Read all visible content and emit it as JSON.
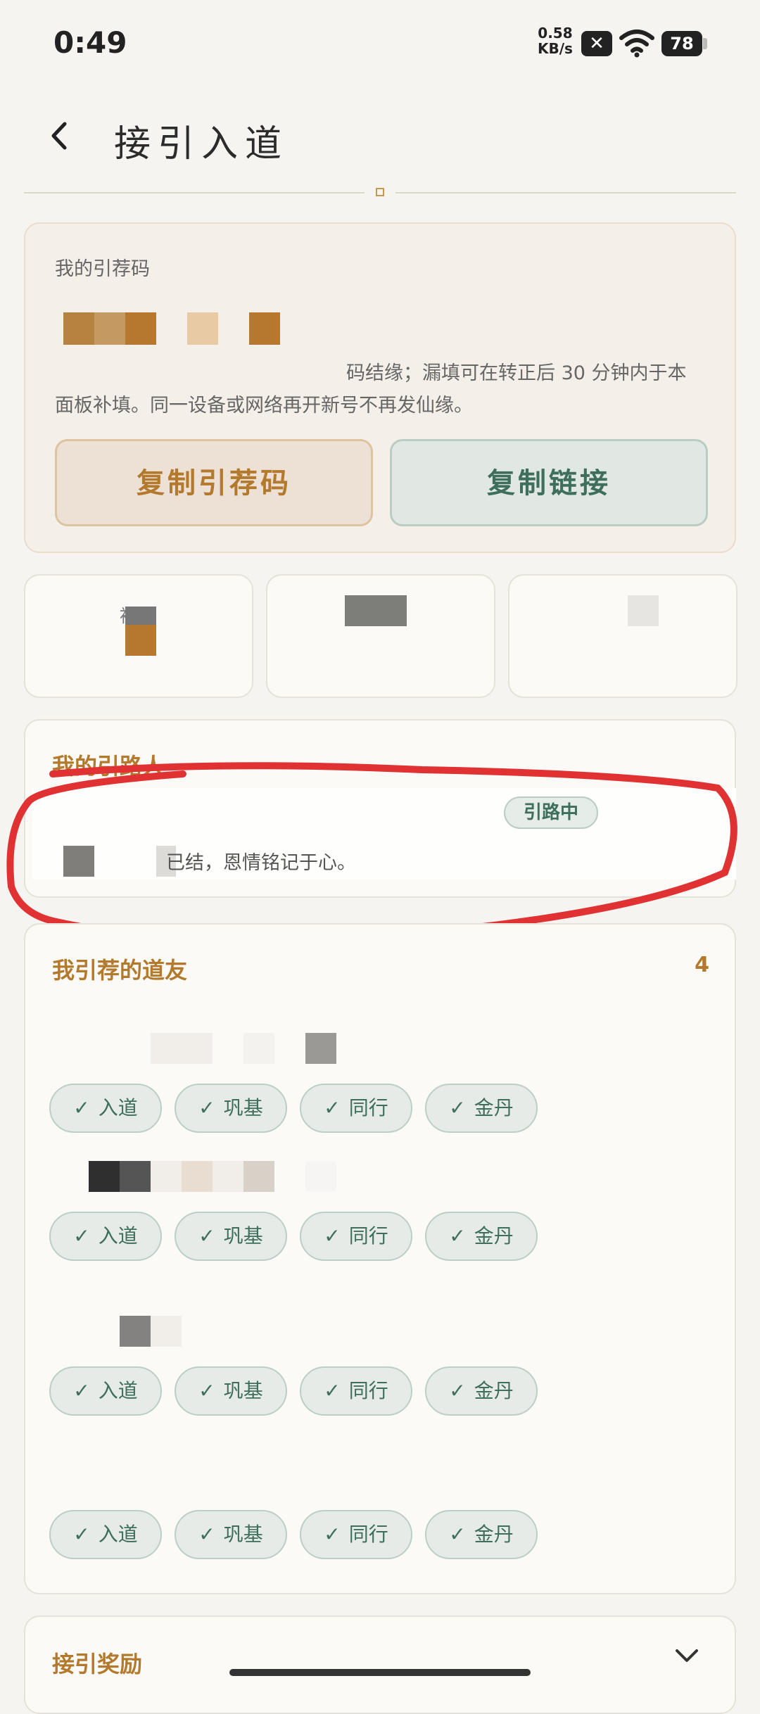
{
  "status_bar": {
    "time": "0:49",
    "net_speed_value": "0.58",
    "net_speed_unit": "KB/s",
    "battery": "78"
  },
  "header": {
    "title": "接引入道"
  },
  "referral_code": {
    "label": "我的引荐码",
    "note_line1": "码结缘；漏填可在转正后 30 分钟内于本",
    "note_line2": "面板补填。同一设备或网络再开新号不再发仙缘。",
    "copy_code_label": "复制引荐码",
    "copy_link_label": "复制链接"
  },
  "stats": {
    "first_label": "被引"
  },
  "guide": {
    "title": "我的引路人",
    "status": "引路中",
    "description": "已结，恩情铭记于心。"
  },
  "friends": {
    "title": "我引荐的道友",
    "count": "4",
    "tag_check_icon": "check-icon",
    "rows": [
      {
        "tags": [
          "入道",
          "巩基",
          "同行",
          "金丹"
        ]
      },
      {
        "tags": [
          "入道",
          "巩基",
          "同行",
          "金丹"
        ]
      },
      {
        "tags": [
          "入道",
          "巩基",
          "同行",
          "金丹"
        ]
      },
      {
        "tags": [
          "入道",
          "巩基",
          "同行",
          "金丹"
        ]
      }
    ]
  },
  "reward": {
    "title": "接引奖励"
  },
  "colors": {
    "accent_gold": "#b3792c",
    "accent_green": "#3e6e5c",
    "annotation_red": "#e03232"
  }
}
